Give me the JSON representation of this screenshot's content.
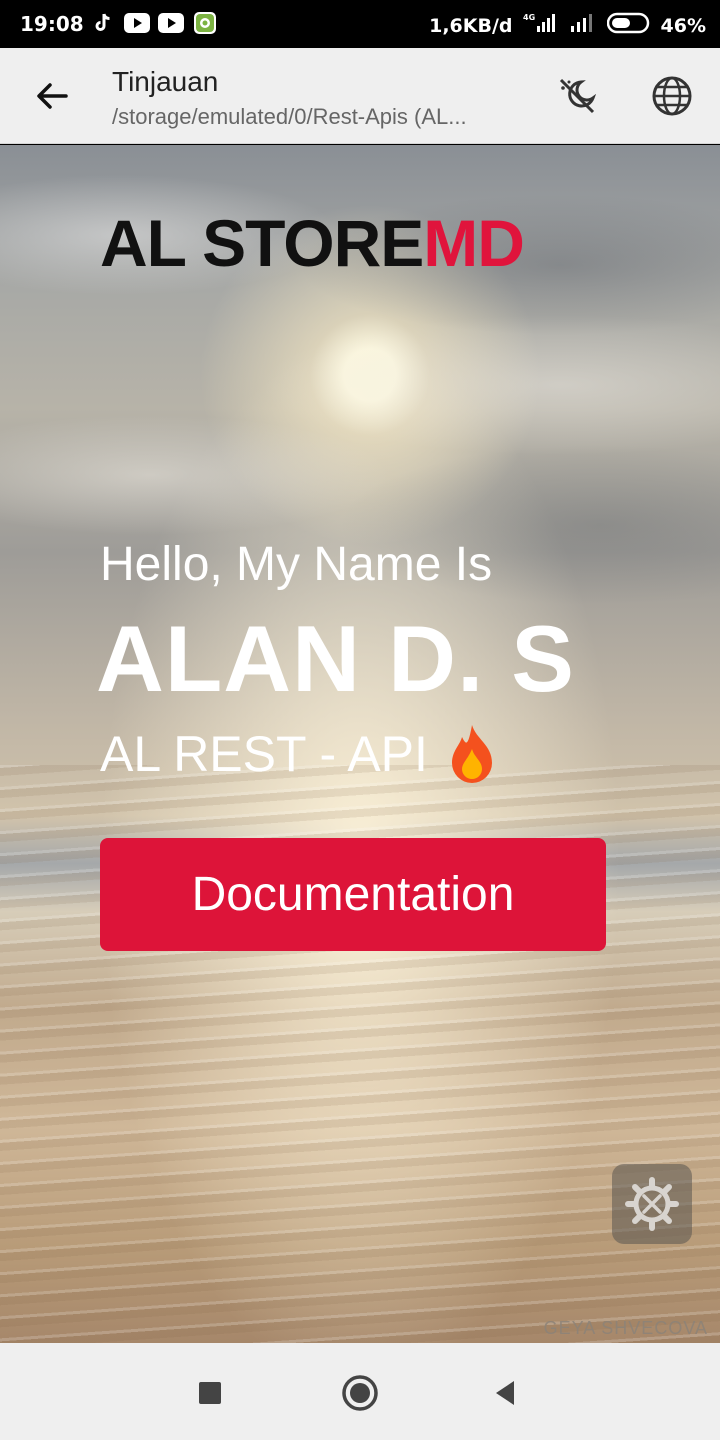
{
  "status_bar": {
    "time": "19:08",
    "net_speed": "1,6KB/d",
    "battery_percent": "46%",
    "network_type": "4G",
    "app_icons": [
      "tiktok-icon",
      "youtube-icon",
      "youtube-icon",
      "android-app-icon"
    ]
  },
  "app_bar": {
    "title": "Tinjauan",
    "subtitle": "/storage/emulated/0/Rest-Apis (AL...",
    "icons": [
      "back-arrow-icon",
      "night-mode-off-icon",
      "globe-icon"
    ]
  },
  "page": {
    "brand_main": "AL STORE",
    "brand_accent": "MD",
    "greeting": "Hello, My Name Is",
    "name": "ALAN D. S",
    "tagline": "AL REST - API",
    "cta_label": "Documentation",
    "watermark": "GEYA SHVECOVA"
  },
  "colors": {
    "accent": "#dd1439",
    "brand_text": "#111111",
    "app_bar_bg": "#efefef"
  },
  "nav_bar": {
    "icons": [
      "recents-square-icon",
      "home-circle-icon",
      "back-triangle-icon"
    ]
  }
}
